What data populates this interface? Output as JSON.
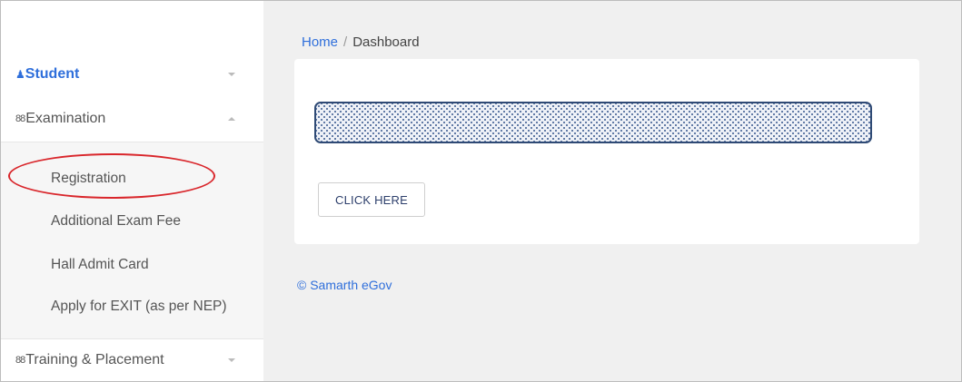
{
  "sidebar": {
    "student": {
      "icon": "user-icon",
      "glyph": "👤",
      "label": "Student"
    },
    "examination": {
      "icon": "users-icon",
      "glyph": "88",
      "label": "Examination",
      "items": [
        {
          "label": "Registration"
        },
        {
          "label": "Additional Exam Fee"
        },
        {
          "label": "Hall Admit Card"
        },
        {
          "label": "Apply for EXIT (as per NEP)"
        }
      ]
    },
    "training": {
      "icon": "users-icon",
      "glyph": "88",
      "label": "Training & Placement"
    }
  },
  "breadcrumb": {
    "home": "Home",
    "separator": "/",
    "current": "Dashboard"
  },
  "card": {
    "button_label": "CLICK HERE"
  },
  "footer": {
    "text": "© Samarth eGov"
  },
  "colors": {
    "accent": "#2f6fdb",
    "highlight": "#d9262b"
  }
}
